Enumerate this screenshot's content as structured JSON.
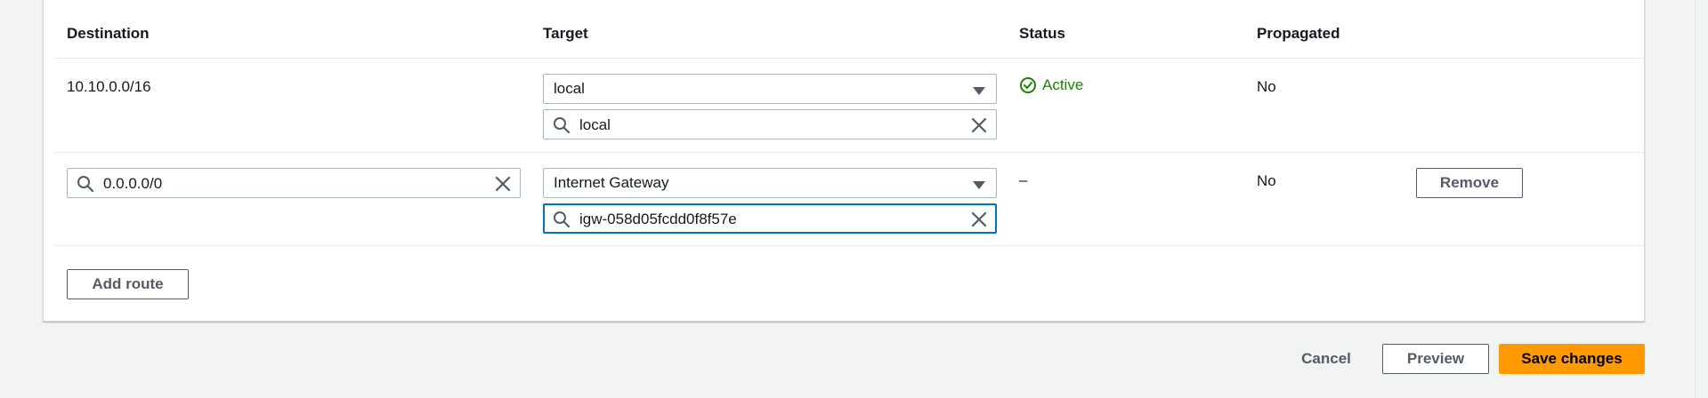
{
  "table": {
    "headers": {
      "destination": "Destination",
      "target": "Target",
      "status": "Status",
      "propagated": "Propagated"
    },
    "rows": [
      {
        "destination": "10.10.0.0/16",
        "target_type": "local",
        "target_value": "local",
        "status": "Active",
        "propagated": "No"
      },
      {
        "destination": "0.0.0.0/0",
        "target_type": "Internet Gateway",
        "target_value": "igw-058d05fcdd0f8f57e",
        "status": "–",
        "propagated": "No",
        "remove_label": "Remove"
      }
    ],
    "add_route_label": "Add route"
  },
  "footer": {
    "cancel_label": "Cancel",
    "preview_label": "Preview",
    "save_label": "Save changes"
  },
  "colors": {
    "status_active": "#1d8102",
    "primary": "#ff9900",
    "focus": "#0073bb"
  }
}
